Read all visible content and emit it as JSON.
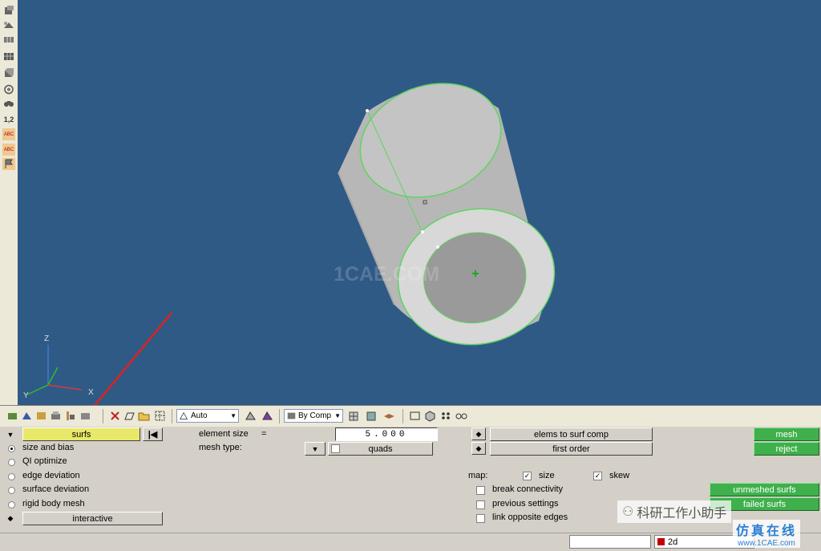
{
  "viewport": {
    "watermark": "1CAE.COM",
    "axes": {
      "z": "Z",
      "y": "Y",
      "x": "X"
    },
    "background": "#2f5a86",
    "model_color": "#c8c8c8",
    "edge_color": "#5fd45f"
  },
  "left_toolbar": {
    "items": [
      {
        "name": "component-icon"
      },
      {
        "name": "elements-icon"
      },
      {
        "name": "nodes-icon"
      },
      {
        "name": "surfaces-icon"
      },
      {
        "name": "solids-icon"
      },
      {
        "name": "rotate-icon"
      },
      {
        "name": "find-icon"
      },
      {
        "name": "numbering-label",
        "text": "1,2"
      },
      {
        "name": "abc-label-icon",
        "text": "ABC"
      },
      {
        "name": "abc-numbers-icon",
        "text": "ABC"
      },
      {
        "name": "flag-icon"
      }
    ]
  },
  "toolbar": {
    "auto_combo": "Auto",
    "by_comp_combo": "By Comp"
  },
  "panel": {
    "selector_label": "surfs",
    "radio_options": [
      {
        "label": "size and bias",
        "selected": true
      },
      {
        "label": "QI optimize",
        "selected": false
      },
      {
        "label": "edge deviation",
        "selected": false
      },
      {
        "label": "surface deviation",
        "selected": false
      },
      {
        "label": "rigid body mesh",
        "selected": false
      }
    ],
    "interactive_label": "interactive",
    "element_size_label": "element size",
    "element_size_eq": "=",
    "element_size_value": "5.000",
    "mesh_type_label": "mesh type:",
    "mesh_type_value": "quads",
    "elems_to_surf_comp": "elems to surf comp",
    "first_order": "first order",
    "map_label": "map:",
    "size_label": "size",
    "skew_label": "skew",
    "checks": [
      {
        "label": "break connectivity",
        "checked": false
      },
      {
        "label": "previous settings",
        "checked": false
      },
      {
        "label": "link opposite edges",
        "checked": false
      }
    ],
    "mesh_button": "mesh",
    "reject_button": "reject",
    "unmeshed_surfs_button": "unmeshed surfs",
    "failed_surfs_button": "failed surfs"
  },
  "status": {
    "component_color": "#c00000",
    "component_name": "2d"
  },
  "overlay": {
    "wechat_label": "科研工作小助手",
    "site_cn": "仿真在线",
    "site_url": "www.1CAE.com"
  }
}
